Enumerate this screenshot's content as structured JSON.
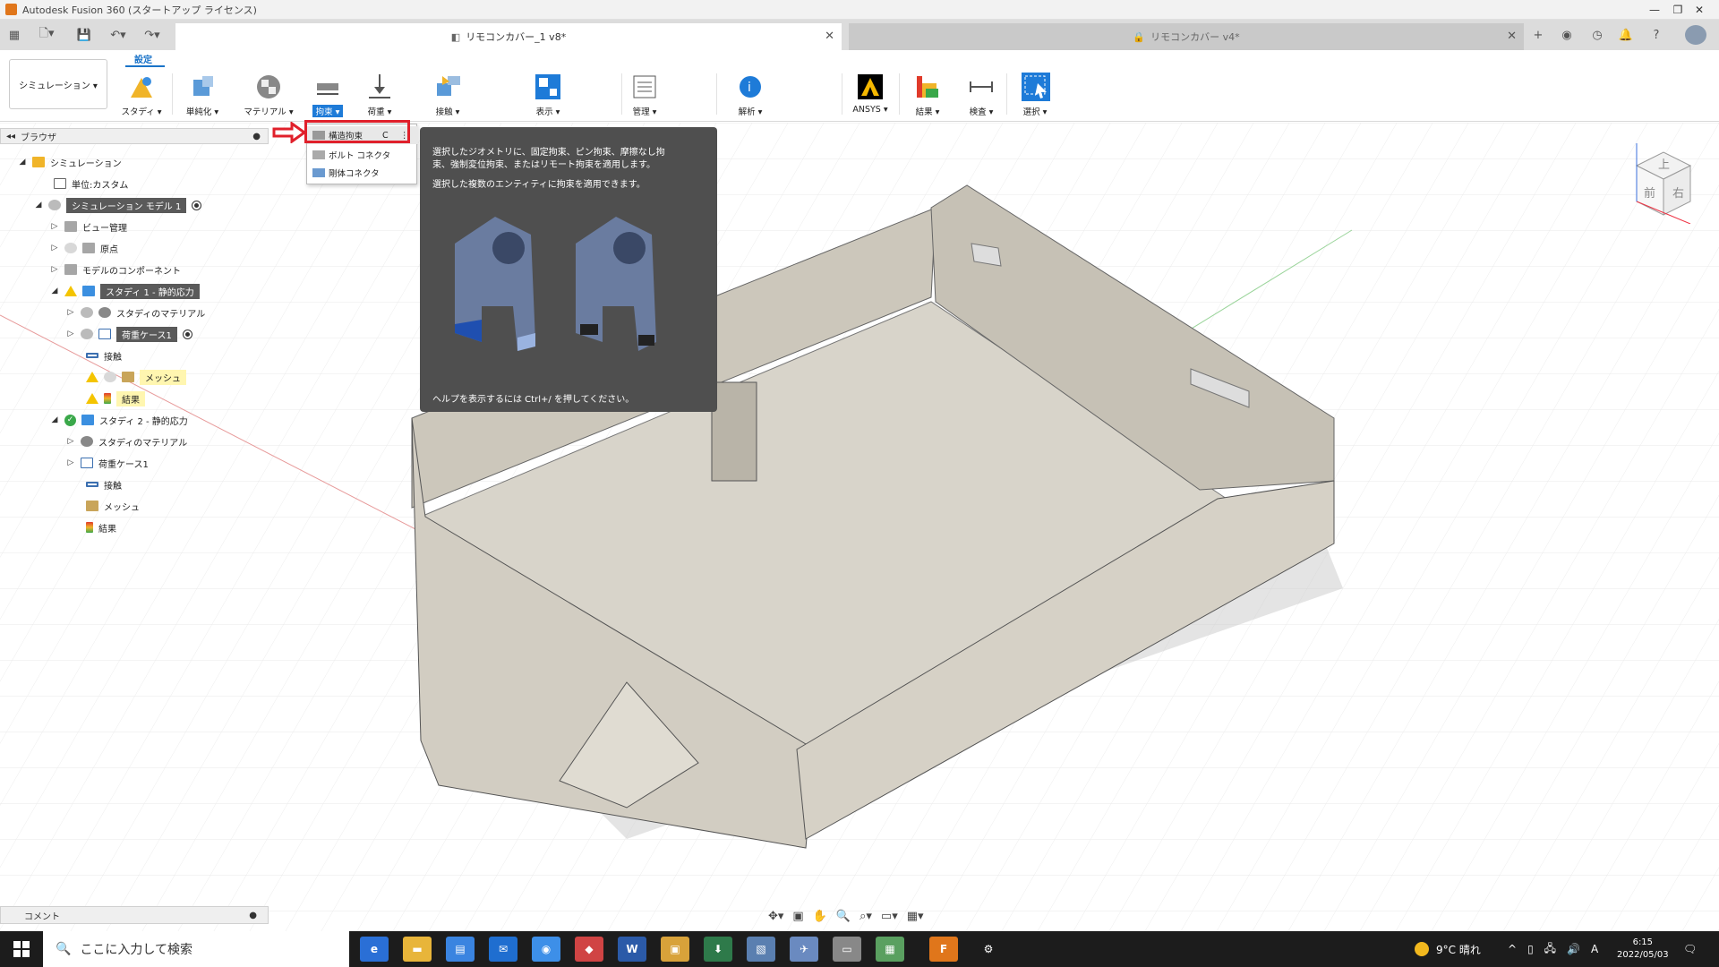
{
  "window": {
    "title": "Autodesk Fusion 360 (スタートアップ ライセンス)"
  },
  "doc_tabs": {
    "active": "リモコンカバー_1 v8*",
    "inactive": "リモコンカバー v4*"
  },
  "toolbar": {
    "workspace": "シミュレーション ▾",
    "tab_label": "設定",
    "tools": [
      "スタディ ▾",
      "単純化 ▾",
      "マテリアル ▾",
      "拘束 ▾",
      "荷重 ▾",
      "接触 ▾",
      "表示 ▾",
      "管理 ▾",
      "解析 ▾",
      "ANSYS ▾",
      "結果 ▾",
      "検査 ▾",
      "選択 ▾"
    ]
  },
  "browser": {
    "header": "ブラウザ",
    "rows": [
      "シミュレーション",
      "単位:カスタム",
      "シミュレーション モデル 1",
      "ビュー管理",
      "原点",
      "モデルのコンポーネント",
      "スタディ 1 - 静的応力",
      "スタディのマテリアル",
      "荷重ケース1",
      "接触",
      "メッシュ",
      "結果",
      "スタディ 2 - 静的応力",
      "スタディのマテリアル",
      "荷重ケース1",
      "接触",
      "メッシュ",
      "結果"
    ]
  },
  "dropdown": {
    "items": [
      "構造拘束",
      "ボルト コネクタ",
      "剛体コネクタ"
    ],
    "shortcut": "C"
  },
  "tooltip": {
    "line1": "選択したジオメトリに、固定拘束、ピン拘束、摩擦なし拘",
    "line2": "束、強制変位拘束、またはリモート拘束を適用します。",
    "line3": "選択した複数のエンティティに拘束を適用できます。",
    "help": "ヘルプを表示するには Ctrl+/ を押してください。"
  },
  "comment": {
    "label": "コメント"
  },
  "viewcube": {
    "top": "上",
    "front": "前",
    "right": "右"
  },
  "taskbar": {
    "search_placeholder": "ここに入力して検索",
    "weather": "9°C 晴れ",
    "ime": "A",
    "time": "6:15",
    "date": "2022/05/03"
  },
  "colors": {
    "accent": "#1e7bd8",
    "highlight_red": "#e0202b",
    "model": "#d8d4ca"
  }
}
